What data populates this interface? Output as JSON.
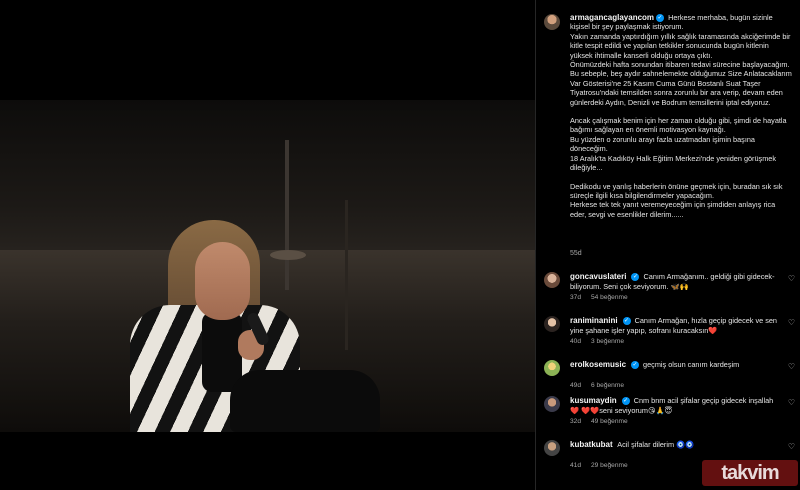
{
  "post": {
    "author": "armagancaglayancom",
    "caption_lines": [
      "Herkese merhaba, bugün sizinle kişisel bir şey paylaşmak istiyorum.",
      "Yakın zamanda yaptırdığım yıllık sağlık taramasında akciğerimde bir kitle tespit edildi ve yapılan tetkikler sonucunda bugün kitlenin yüksek ihtimalle kanserli olduğu ortaya çıktı.",
      "Önümüzdeki hafta sonundan itibaren tedavi sürecine başlayacağım.",
      "Bu sebeple, beş aydır sahnelemekte olduğumuz Size Anlatacaklarım Var Gösterisi'ne 25 Kasım Cuma Günü Bostanlı Suat Taşer Tiyatrosu'ndaki temsilden sonra zorunlu bir ara verip, devam eden günlerdeki Aydın, Denizli ve Bodrum temsillerini iptal ediyoruz.",
      "",
      "Ancak çalışmak benim için her zaman olduğu gibi, şimdi de hayatla bağımı sağlayan en önemli motivasyon kaynağı.",
      "Bu yüzden o zorunlu arayı fazla uzatmadan işimin başına döneceğim.",
      "18 Aralık'ta Kadıköy Halk Eğitim Merkezi'nde yeniden görüşmek dileğiyle...",
      "",
      "Dedikodu ve yanlış haberlerin önüne geçmek için, buradan sık sık süreçle ilgili kısa bilgilendirmeler yapacağım.",
      "Herkese tek tek yanıt veremeyeceğim için şimdiden anlayış rica eder, sevgi ve esenlikler dilerim......"
    ],
    "age": "55d"
  },
  "comments": [
    {
      "user": "goncavuslateri",
      "text": "Canım Armağanım.. geldiği gibi gidecek- biliyorum. Seni çok seviyorum. 🦋🙌",
      "age": "37d",
      "likes": "54 beğenme",
      "avatar_class": "av1"
    },
    {
      "user": "raniminanini",
      "text": "Canım Armağan, hızla geçip gidecek ve sen yine şahane işler yapıp, sofranı kuracaksın❤️",
      "age": "40d",
      "likes": "3 beğenme",
      "avatar_class": "av2"
    },
    {
      "user": "erolkosemusic",
      "text": "geçmiş olsun canım kardeşim",
      "age": "49d",
      "likes": "6 beğenme",
      "avatar_class": "av3"
    },
    {
      "user": "kusumaydin",
      "text": "Cnm bnm acil şifalar geçip gidecek inşallah❤️ ❤️❤️seni seviyorum😘🙏😇",
      "age": "32d",
      "likes": "49 beğenme",
      "avatar_class": "av4"
    },
    {
      "user": "kubatkubat",
      "text": "Acil şifalar dilerim 🧿🧿",
      "age": "41d",
      "likes": "29 beğenme",
      "avatar_class": "av5"
    }
  ],
  "watermark": "takvim"
}
